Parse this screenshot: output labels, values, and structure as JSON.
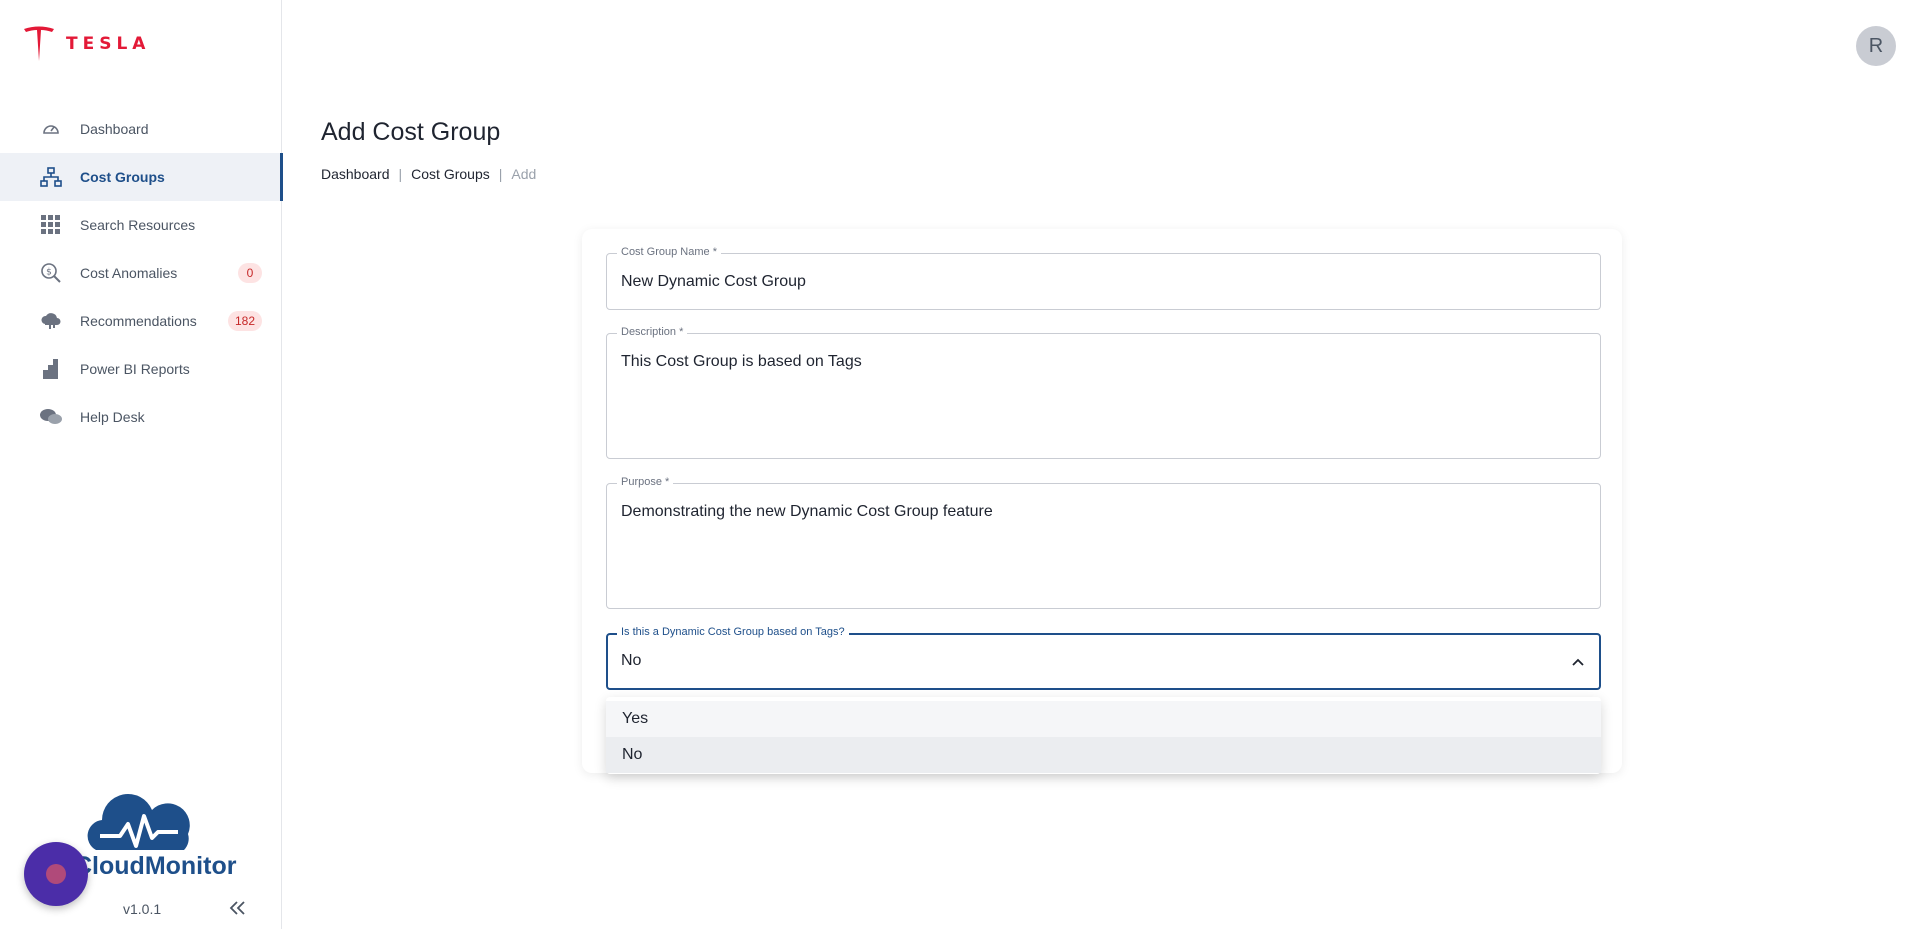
{
  "app": {
    "brand_logo": "TESLA",
    "product_name": "CloudMonitor",
    "version": "v1.0.1"
  },
  "user": {
    "avatar_initial": "R"
  },
  "sidebar": {
    "items": [
      {
        "label": "Dashboard",
        "icon": "gauge-icon"
      },
      {
        "label": "Cost Groups",
        "icon": "hierarchy-icon",
        "active": true
      },
      {
        "label": "Search Resources",
        "icon": "grid-icon"
      },
      {
        "label": "Cost Anomalies",
        "icon": "dollar-search-icon",
        "badge": "0"
      },
      {
        "label": "Recommendations",
        "icon": "cloud-icon",
        "badge": "182"
      },
      {
        "label": "Power BI Reports",
        "icon": "bar-chart-icon"
      },
      {
        "label": "Help Desk",
        "icon": "chat-icon"
      }
    ]
  },
  "page": {
    "title": "Add Cost Group",
    "breadcrumb": [
      "Dashboard",
      "Cost Groups",
      "Add"
    ]
  },
  "form": {
    "name": {
      "label": "Cost Group Name *",
      "value": "New Dynamic Cost Group"
    },
    "description": {
      "label": "Description *",
      "value": "This Cost Group is based on Tags"
    },
    "purpose": {
      "label": "Purpose *",
      "value": "Demonstrating the new Dynamic Cost Group feature"
    },
    "dynamic": {
      "label": "Is this a Dynamic Cost Group based on Tags?",
      "value": "No",
      "options": [
        "Yes",
        "No"
      ]
    }
  },
  "colors": {
    "accent": "#1e4f8a",
    "brand": "#e31937",
    "badge_bg": "#fde3e3",
    "badge_text": "#c62828"
  }
}
